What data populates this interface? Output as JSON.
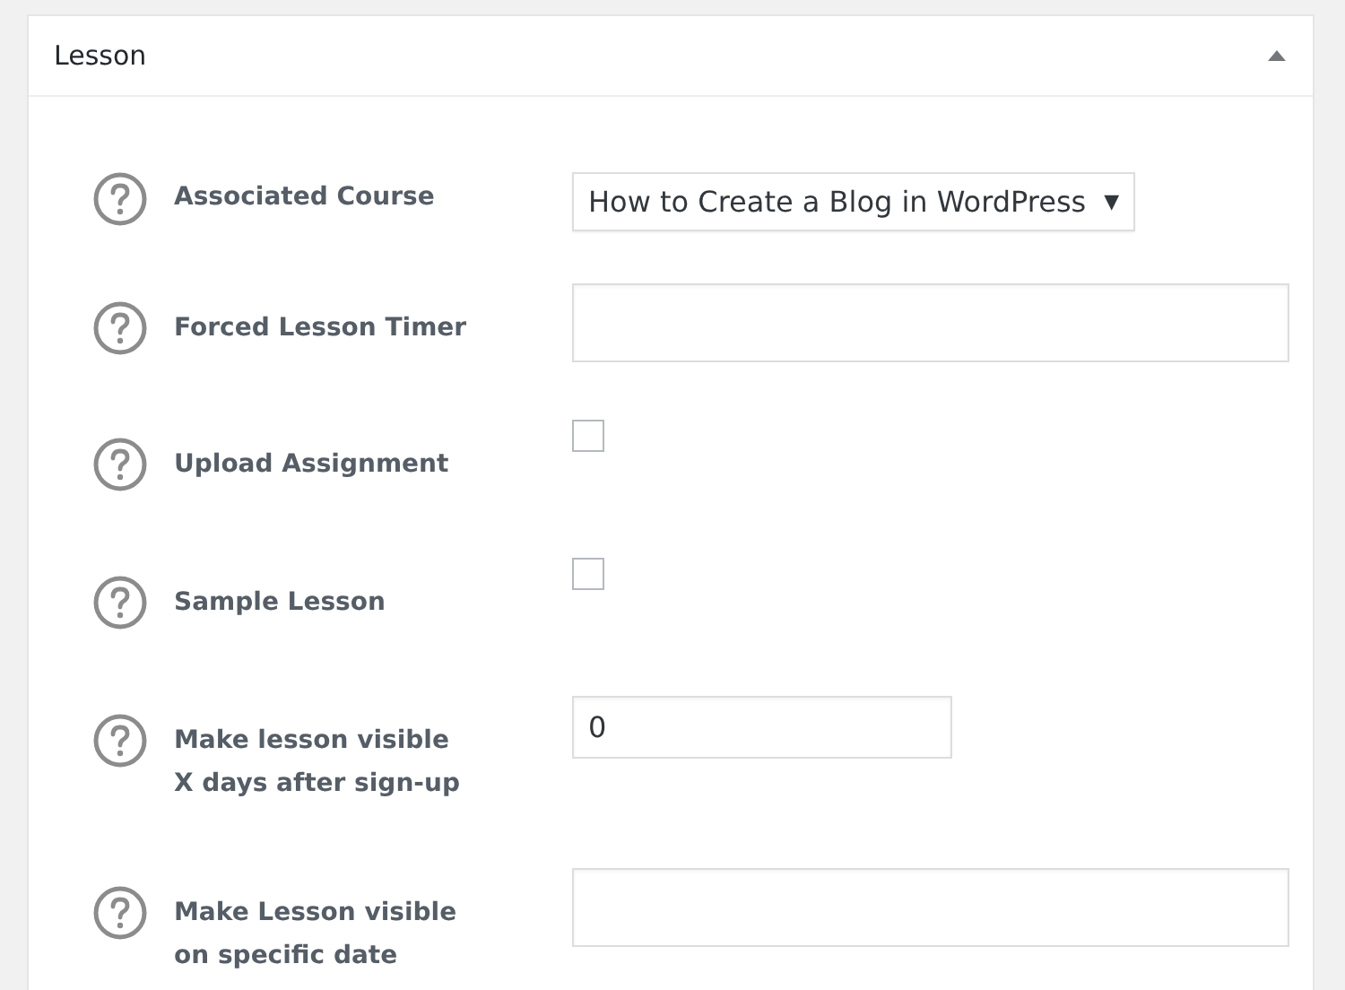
{
  "panel": {
    "title": "Lesson",
    "expanded": true
  },
  "fields": [
    {
      "kind": "select",
      "label": "Associated Course",
      "value": "How to Create a Blog in WordPress",
      "arrow": "▼"
    },
    {
      "kind": "text",
      "label": "Forced Lesson Timer"
    },
    {
      "kind": "checkbox",
      "label": "Upload Assignment",
      "checked": false
    },
    {
      "kind": "checkbox",
      "label": "Sample Lesson",
      "checked": false
    },
    {
      "kind": "number",
      "label": "Make lesson visible\nX days after sign-up",
      "value": "0"
    },
    {
      "kind": "text",
      "label": "Make Lesson visible\non specific date"
    }
  ]
}
